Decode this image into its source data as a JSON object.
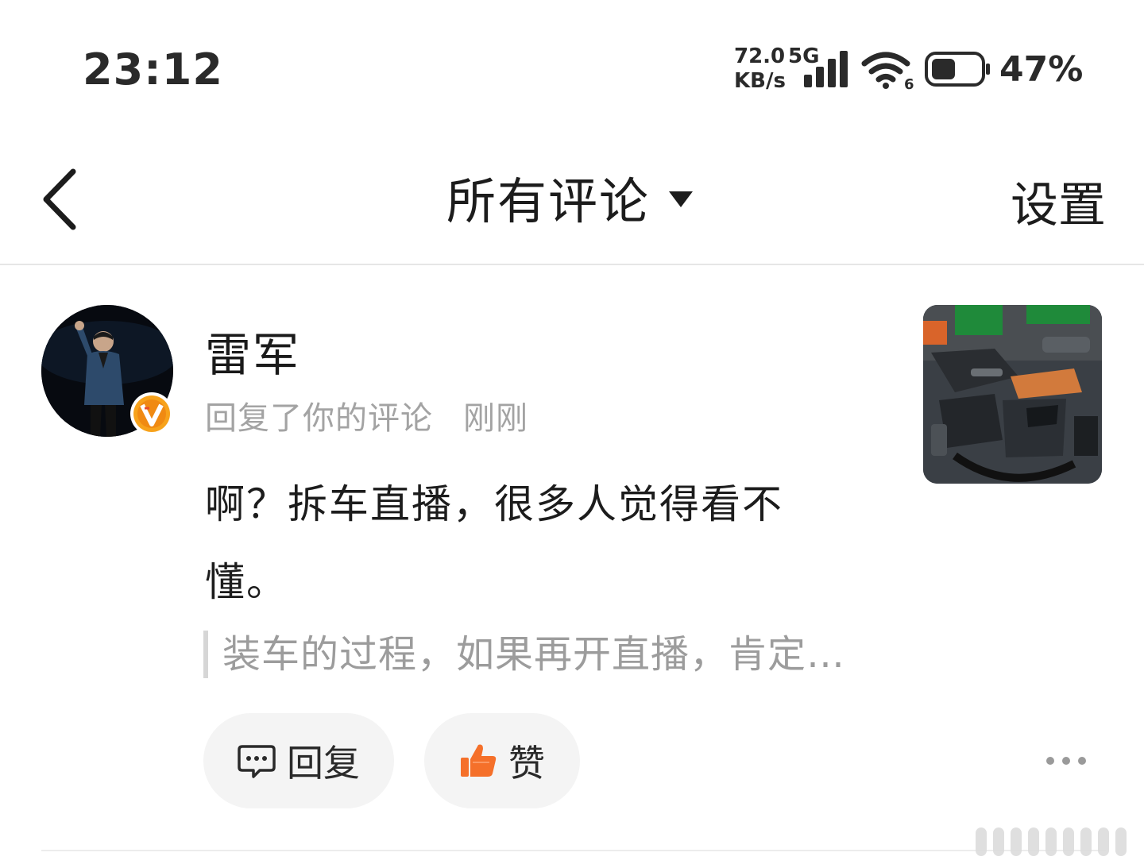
{
  "status_bar": {
    "time": "23:12",
    "net_speed_value": "72.0",
    "net_speed_unit": "KB/s",
    "net_type": "5G",
    "wifi_badge": "6",
    "battery_percent": "47%",
    "battery_level": 0.47,
    "icons": [
      "signal-icon",
      "wifi-icon",
      "battery-icon"
    ]
  },
  "header": {
    "title": "所有评论",
    "settings_label": "设置",
    "icons": [
      "back-icon",
      "dropdown-triangle-icon"
    ]
  },
  "comment": {
    "username": "雷军",
    "action_text": "回复了你的评论",
    "time_text": "刚刚",
    "body_text": "啊？拆车直播，很多人觉得看不懂。",
    "quoted_text": "装车的过程，如果再开直播，肯定…",
    "reply_label": "回复",
    "like_label": "赞",
    "icons": [
      "verified-badge-icon",
      "comment-bubble-icon",
      "thumbs-up-icon",
      "more-dots-icon"
    ]
  },
  "colors": {
    "text_primary": "#1c1c1c",
    "text_secondary": "#a3a3a3",
    "button_bg": "#f4f4f4",
    "like_orange": "#f5702a",
    "badge_orange": "#f7a21b"
  }
}
